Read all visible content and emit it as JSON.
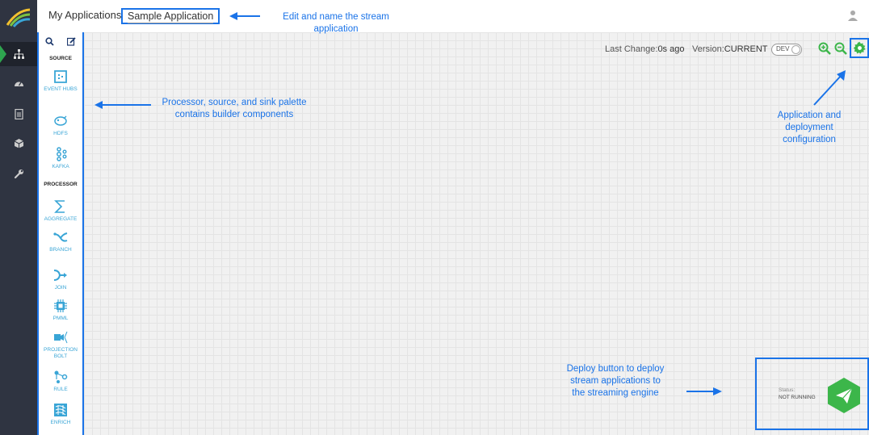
{
  "header": {
    "breadcrumb_root": "My Applications",
    "app_name": "Sample Application"
  },
  "leftnav": {
    "items": [
      {
        "icon": "sitemap-icon"
      },
      {
        "icon": "dashboard-icon"
      },
      {
        "icon": "document-icon"
      },
      {
        "icon": "cube-icon"
      },
      {
        "icon": "wrench-icon"
      }
    ]
  },
  "palette": {
    "source_heading": "SOURCE",
    "processor_heading": "PROCESSOR",
    "source_items": [
      {
        "label": "EVENT HUBS",
        "icon": "event-hubs-icon"
      },
      {
        "label": "HDFS",
        "icon": "hdfs-icon"
      },
      {
        "label": "KAFKA",
        "icon": "kafka-icon"
      }
    ],
    "processor_items": [
      {
        "label": "AGGREGATE",
        "icon": "sigma-icon"
      },
      {
        "label": "BRANCH",
        "icon": "branch-icon"
      },
      {
        "label": "JOIN",
        "icon": "join-icon"
      },
      {
        "label": "PMML",
        "icon": "chip-icon"
      },
      {
        "label": "PROJECTION BOLT",
        "icon": "projection-icon"
      },
      {
        "label": "RULE",
        "icon": "rule-icon"
      },
      {
        "label": "ENRICH",
        "icon": "enrich-icon"
      }
    ]
  },
  "toolbar": {
    "last_change_label": "Last Change:",
    "last_change_value": "0s ago",
    "version_label": "Version:",
    "version_value": "CURRENT",
    "env_toggle": "DEV"
  },
  "deploy": {
    "status_label": "Status:",
    "status_value": "NOT RUNNING"
  },
  "annotations": {
    "name": "Edit and name the stream application",
    "palette": "Processor, source, and sink palette contains builder components",
    "config": "Application and deployment configuration",
    "deploy": "Deploy button to deploy stream applications to the streaming engine"
  },
  "colors": {
    "accent": "#1a73e8",
    "nav_bg": "#2f3441",
    "palette_icon": "#39a5d6",
    "deploy_green": "#3cb64a",
    "active_green": "#2ea44f"
  }
}
